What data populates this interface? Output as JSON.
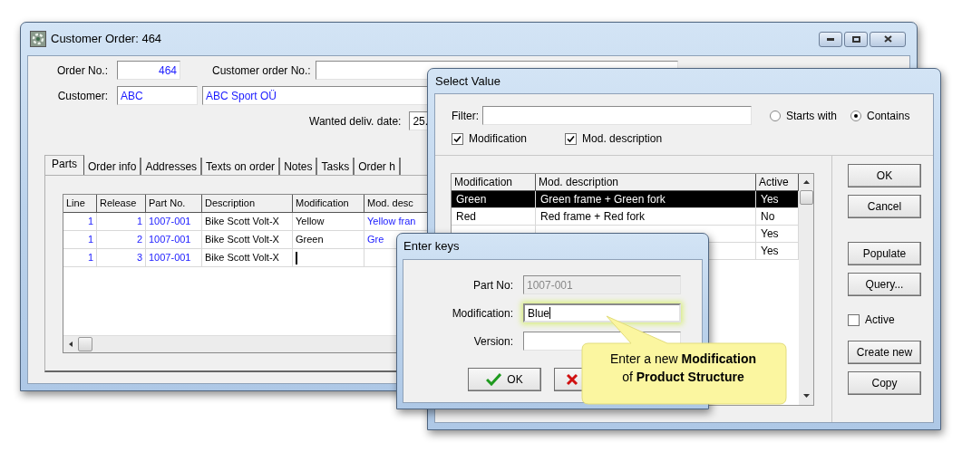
{
  "main_window": {
    "title": "Customer Order: 464",
    "fields": {
      "order_no_label": "Order No.:",
      "order_no": "464",
      "customer_order_no_label": "Customer order No.:",
      "customer_label": "Customer:",
      "customer_code": "ABC",
      "customer_name": "ABC Sport OÜ",
      "wanted_date_label": "Wanted deliv. date:",
      "wanted_date": "25."
    },
    "tabs": [
      {
        "label": "Parts",
        "selected": true
      },
      {
        "label": "Order info",
        "selected": false
      },
      {
        "label": "Addresses",
        "selected": false
      },
      {
        "label": "Texts on order",
        "selected": false
      },
      {
        "label": "Notes",
        "selected": false
      },
      {
        "label": "Tasks",
        "selected": false
      },
      {
        "label": "Order h",
        "selected": false
      }
    ],
    "grid": {
      "columns": [
        {
          "label": "Line",
          "kind": "number"
        },
        {
          "label": "Release",
          "kind": "number"
        },
        {
          "label": "Part No.",
          "kind": "link"
        },
        {
          "label": "Description",
          "kind": "text"
        },
        {
          "label": "Modification",
          "kind": "text"
        },
        {
          "label": "Mod. desc",
          "kind": "link"
        }
      ],
      "rows": [
        {
          "cells": [
            "1",
            "1",
            "1007-001",
            "Bike Scott Volt-X",
            "Yellow",
            "Yellow fran"
          ],
          "editing": false
        },
        {
          "cells": [
            "1",
            "2",
            "1007-001",
            "Bike Scott Volt-X",
            "Green",
            "Gre"
          ],
          "editing": false
        },
        {
          "cells": [
            "1",
            "3",
            "1007-001",
            "Bike Scott Volt-X"
          ],
          "editing": true
        }
      ]
    }
  },
  "select_window": {
    "title": "Select Value",
    "filter_label": "Filter:",
    "match_options": [
      {
        "label": "Starts with",
        "selected": false
      },
      {
        "label": "Contains",
        "selected": true
      }
    ],
    "search_in": [
      {
        "label": "Modification",
        "checked": true
      },
      {
        "label": "Mod. description",
        "checked": true
      }
    ],
    "columns": [
      "Modification",
      "Mod. description",
      "Active"
    ],
    "rows": [
      {
        "modification": "Green",
        "description": "Green frame + Green fork",
        "active": "Yes",
        "selected": true
      },
      {
        "modification": "Red",
        "description": "Red frame + Red fork",
        "active": "No",
        "selected": false
      },
      {
        "active": "Yes",
        "selected": false
      },
      {
        "active": "Yes",
        "selected": false
      }
    ],
    "buttons": [
      {
        "kind": "button",
        "label": "OK"
      },
      {
        "kind": "button",
        "label": "Cancel"
      },
      {
        "kind": "spacer"
      },
      {
        "kind": "button",
        "label": "Populate"
      },
      {
        "kind": "button",
        "label": "Query..."
      },
      {
        "kind": "checkbox",
        "label": "Active",
        "checked": false
      },
      {
        "kind": "button",
        "label": "Create new"
      },
      {
        "kind": "button",
        "label": "Copy"
      }
    ]
  },
  "enter_keys": {
    "title": "Enter keys",
    "fields": [
      {
        "label": "Part No:",
        "value": "1007-001",
        "disabled": true,
        "focused": false
      },
      {
        "label": "Modification:",
        "value": "Blue",
        "disabled": false,
        "focused": true
      },
      {
        "label": "Version:",
        "disabled": false,
        "focused": false
      }
    ],
    "buttons": [
      {
        "kind": "ok",
        "label": "OK"
      },
      {
        "kind": "cancel"
      }
    ]
  },
  "callout": {
    "text": "Enter a new **Modification**\nof **Product Structure**"
  }
}
